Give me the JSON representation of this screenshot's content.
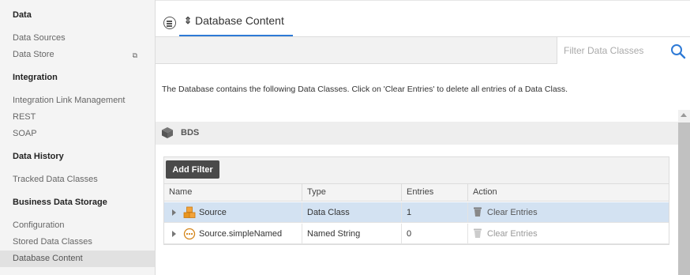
{
  "sidebar": {
    "sections": [
      {
        "title": "Data",
        "items": [
          {
            "label": "Data Sources"
          },
          {
            "label": "Data Store",
            "external": true
          }
        ]
      },
      {
        "title": "Integration",
        "items": [
          {
            "label": "Integration Link Management"
          },
          {
            "label": "REST"
          },
          {
            "label": "SOAP"
          }
        ]
      },
      {
        "title": "Data History",
        "items": [
          {
            "label": "Tracked Data Classes"
          }
        ]
      },
      {
        "title": "Business Data Storage",
        "items": [
          {
            "label": "Configuration"
          },
          {
            "label": "Stored Data Classes"
          },
          {
            "label": "Database Content",
            "active": true
          }
        ]
      }
    ]
  },
  "header": {
    "menu_icon": "list-circle-icon",
    "tab_icon": "sort-arrows-icon",
    "tab_glyph": "⇕",
    "tab_label": "Database Content"
  },
  "filter": {
    "placeholder": "Filter Data Classes",
    "value": "",
    "icon": "search-icon"
  },
  "description": "The Database contains the following Data Classes. Click on 'Clear Entries' to delete all entries of a Data Class.",
  "section": {
    "icon": "cube-icon",
    "title": "BDS"
  },
  "grid": {
    "add_filter_label": "Add Filter",
    "columns": [
      "Name",
      "Type",
      "Entries",
      "Action"
    ],
    "rows": [
      {
        "name": "Source",
        "type": "Data Class",
        "entries": "1",
        "action": "Clear Entries",
        "icon": "data-class-icon",
        "selected": true,
        "action_enabled": true
      },
      {
        "name": "Source.simpleNamed",
        "type": "Named String",
        "entries": "0",
        "action": "Clear Entries",
        "icon": "named-string-icon",
        "selected": false,
        "action_enabled": false
      }
    ]
  },
  "colors": {
    "accent": "#2e7ad6",
    "selected_row": "#d3e2f2",
    "button_dark": "#4a4a4a",
    "data_class_icon": "#e8951f"
  }
}
